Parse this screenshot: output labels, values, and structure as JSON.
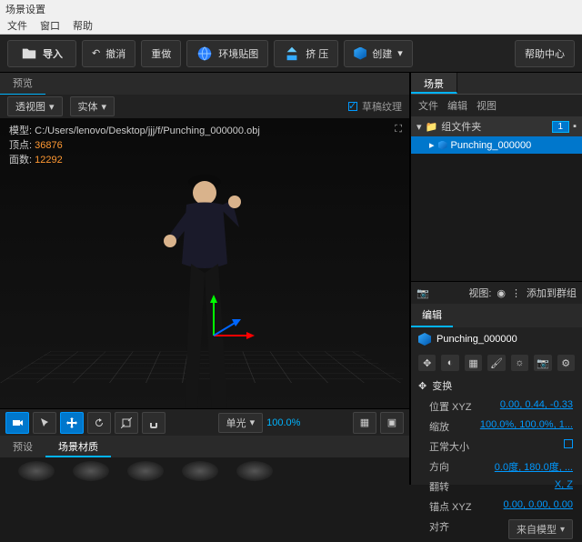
{
  "title": "场景设置",
  "menu": {
    "file": "文件",
    "window": "窗口",
    "help": "帮助"
  },
  "toolbar": {
    "import": "导入",
    "undo": "撤消",
    "redo": "重做",
    "envmap": "环境贴图",
    "extrude": "挤 压",
    "create": "创建",
    "helpcenter": "帮助中心"
  },
  "left": {
    "previewTab": "预览",
    "viewMode": "透视图",
    "display": "实体",
    "roughTex": "草稿纹理",
    "info": {
      "modelLabel": "模型:",
      "modelPath": "C:/Users/lenovo/Desktop/jjj/f/Punching_000000.obj",
      "vertLabel": "顶点:",
      "vertCount": "36876",
      "faceLabel": "面数:",
      "faceCount": "12292"
    },
    "shading": "单光",
    "shadingPct": "100.0%",
    "bottomTabs": {
      "preset": "预设",
      "material": "场景材质"
    }
  },
  "right": {
    "sceneTab": "场景",
    "sub": {
      "file": "文件",
      "edit": "编辑",
      "view": "视图"
    },
    "folder": "组文件夹",
    "count": "1",
    "item": "Punching_000000",
    "viewLabel": "视图:",
    "addGroup": "添加到群组",
    "editTab": "编辑",
    "objName": "Punching_000000",
    "transform": "变换",
    "props": {
      "posLabel": "位置 XYZ",
      "posVal": "0.00, 0.44, -0.33",
      "scaleLabel": "缩放",
      "scaleVal": "100.0%, 100.0%, 1...",
      "sizeLabel": "正常大小",
      "dirLabel": "方向",
      "dirVal": "0.0度, 180.0度, ...",
      "flipLabel": "翻转",
      "flipVal": "X, Z",
      "anchorLabel": "锚点 XYZ",
      "anchorVal": "0.00, 0.00, 0.00",
      "alignLabel": "对齐",
      "alignVal": "来自模型"
    }
  }
}
